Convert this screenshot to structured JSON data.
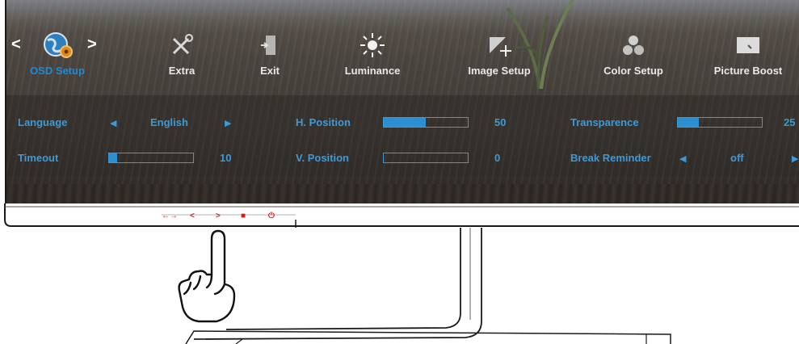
{
  "menu": {
    "items": [
      {
        "label": "OSD Setup",
        "icon": "globe-gear-icon",
        "active": true
      },
      {
        "label": "Extra",
        "icon": "tools-icon"
      },
      {
        "label": "Exit",
        "icon": "exit-door-icon"
      },
      {
        "label": "Luminance",
        "icon": "sun-icon"
      },
      {
        "label": "Image Setup",
        "icon": "image-setup-icon"
      },
      {
        "label": "Color Setup",
        "icon": "color-circles-icon"
      },
      {
        "label": "Picture Boost",
        "icon": "picture-boost-icon"
      }
    ],
    "accent_color": "#1f8ad6"
  },
  "settings": {
    "language": {
      "label": "Language",
      "value": "English"
    },
    "timeout": {
      "label": "Timeout",
      "value": "10",
      "level": 10
    },
    "h_position": {
      "label": "H. Position",
      "value": "50",
      "level": 50
    },
    "v_position": {
      "label": "V. Position",
      "value": "0",
      "level": 0
    },
    "transparence": {
      "label": "Transparence",
      "value": "25",
      "level": 25
    },
    "break_reminder": {
      "label": "Break Reminder",
      "value": "off"
    }
  },
  "monitor_buttons": [
    {
      "name": "source-auto-button",
      "glyph": "←→"
    },
    {
      "name": "left-button",
      "glyph": "<"
    },
    {
      "name": "right-button",
      "glyph": ">"
    },
    {
      "name": "menu-button",
      "glyph": "■"
    },
    {
      "name": "power-button",
      "glyph": "⏻"
    }
  ],
  "colors": {
    "label_blue": "#3d9ad8",
    "button_red": "#d21e1e"
  }
}
